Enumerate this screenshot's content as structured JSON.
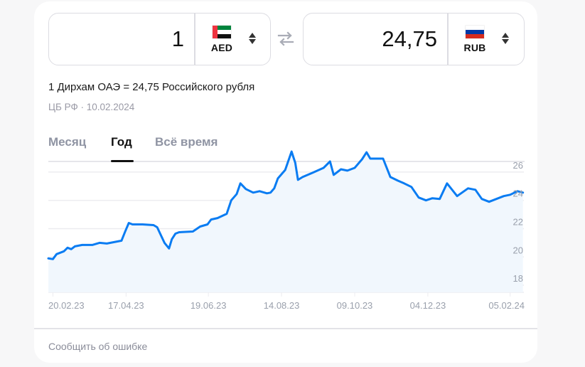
{
  "converter": {
    "from": {
      "amount": "1",
      "code": "AED",
      "flag": "uae-flag"
    },
    "to": {
      "amount": "24,75",
      "code": "RUB",
      "flag": "russia-flag"
    },
    "swap_icon": "swap-arrows-icon",
    "sort_icon": "up-down-arrows-icon"
  },
  "rate_text": "1 Дирхам ОАЭ = 24,75 Российского рубля",
  "source_text": "ЦБ РФ · 10.02.2024",
  "tabs": [
    {
      "label": "Месяц",
      "active": false
    },
    {
      "label": "Год",
      "active": true
    },
    {
      "label": "Всё время",
      "active": false
    }
  ],
  "footer": {
    "report_label": "Сообщить об ошибке"
  },
  "colors": {
    "line": "#0a7cf2",
    "area": "#f1f7fd",
    "grid": "#ececf0",
    "tick": "#9aa0ac"
  },
  "chart_data": {
    "type": "area",
    "title": "",
    "xlabel": "",
    "ylabel": "",
    "ylim": [
      17.5,
      26.6
    ],
    "grid": true,
    "legend": "none",
    "y_ticks": [
      "26",
      "24",
      "22",
      "20",
      "18"
    ],
    "y_tick_values": [
      26,
      24,
      22,
      20,
      18
    ],
    "x_ticks": [
      "20.02.23",
      "17.04.23",
      "19.06.23",
      "14.08.23",
      "09.10.23",
      "04.12.23",
      "05.02.24"
    ],
    "x_tick_positions": [
      0.5,
      8.5,
      17.5,
      25.5,
      33.5,
      41.5,
      50.5
    ],
    "x_range": [
      0,
      52
    ],
    "series": [
      {
        "name": "AED/RUB",
        "x": [
          0,
          0.5,
          0.9,
          1.7,
          2.1,
          2.5,
          2.9,
          3.7,
          4.8,
          5.6,
          6.4,
          7.2,
          8.0,
          8.4,
          8.8,
          9.2,
          10.3,
          11.5,
          11.9,
          12.3,
          12.7,
          13.2,
          13.5,
          13.9,
          14.3,
          15.8,
          16.6,
          17.4,
          17.8,
          18.5,
          19.5,
          20.0,
          20.6,
          21.0,
          21.6,
          22.4,
          23.1,
          23.9,
          24.3,
          24.7,
          25.1,
          25.9,
          26.6,
          27.0,
          27.3,
          27.8,
          28.9,
          30.1,
          30.8,
          31.2,
          32.0,
          32.7,
          33.5,
          34.3,
          34.8,
          35.2,
          36.6,
          37.4,
          38.2,
          38.9,
          39.7,
          40.5,
          41.3,
          42.0,
          42.8,
          43.6,
          44.7,
          45.9,
          46.7,
          47.4,
          48.2,
          49.0,
          49.8,
          50.5,
          51.3,
          51.9
        ],
        "values": [
          19.9,
          19.85,
          20.2,
          20.4,
          20.65,
          20.55,
          20.75,
          20.85,
          20.85,
          21.0,
          20.95,
          21.05,
          21.15,
          21.8,
          22.4,
          22.3,
          22.3,
          22.25,
          22.1,
          21.55,
          21.0,
          20.6,
          21.25,
          21.65,
          21.75,
          21.8,
          22.15,
          22.3,
          22.65,
          22.75,
          23.05,
          24.0,
          24.45,
          25.2,
          24.8,
          24.55,
          24.65,
          24.5,
          24.55,
          24.85,
          25.55,
          26.15,
          27.45,
          26.65,
          25.45,
          25.65,
          25.95,
          26.3,
          26.75,
          25.8,
          26.2,
          26.1,
          26.3,
          26.9,
          27.4,
          26.95,
          26.95,
          25.65,
          25.4,
          25.2,
          24.95,
          24.2,
          24.0,
          24.15,
          24.1,
          25.2,
          24.3,
          24.85,
          24.75,
          24.1,
          23.9,
          24.1,
          24.3,
          24.4,
          24.65,
          24.55
        ]
      }
    ]
  }
}
